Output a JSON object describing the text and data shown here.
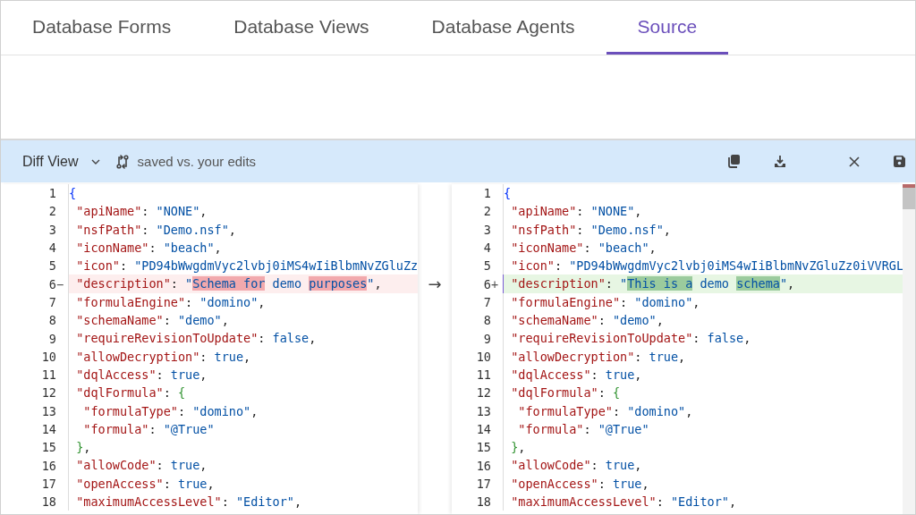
{
  "tabs": [
    {
      "label": "Database Forms",
      "selected": false
    },
    {
      "label": "Database Views",
      "selected": false
    },
    {
      "label": "Database Agents",
      "selected": false
    },
    {
      "label": "Source",
      "selected": true
    }
  ],
  "toolbar": {
    "view_mode": "Diff View",
    "comparison": "saved vs. your edits"
  },
  "editor": {
    "left": {
      "lines": [
        {
          "number": "1",
          "kind": "unchanged",
          "segments": [
            {
              "text": "{",
              "kind": "brace-outer"
            }
          ]
        },
        {
          "number": "2",
          "kind": "unchanged",
          "segments": [
            {
              "text": " \"apiName\"",
              "kind": "key"
            },
            {
              "text": ": ",
              "kind": "punct"
            },
            {
              "text": "\"NONE\"",
              "kind": "string"
            },
            {
              "text": ",",
              "kind": "punct"
            }
          ]
        },
        {
          "number": "3",
          "kind": "unchanged",
          "segments": [
            {
              "text": " \"nsfPath\"",
              "kind": "key"
            },
            {
              "text": ": ",
              "kind": "punct"
            },
            {
              "text": "\"Demo.nsf\"",
              "kind": "string"
            },
            {
              "text": ",",
              "kind": "punct"
            }
          ]
        },
        {
          "number": "4",
          "kind": "unchanged",
          "segments": [
            {
              "text": " \"iconName\"",
              "kind": "key"
            },
            {
              "text": ": ",
              "kind": "punct"
            },
            {
              "text": "\"beach\"",
              "kind": "string"
            },
            {
              "text": ",",
              "kind": "punct"
            }
          ]
        },
        {
          "number": "5",
          "kind": "unchanged",
          "segments": [
            {
              "text": " \"icon\"",
              "kind": "key"
            },
            {
              "text": ": ",
              "kind": "punct"
            },
            {
              "text": "\"PD94bWwgdmVyc2lvbj0iMS4wIiBlbmNvZGluZz",
              "kind": "string"
            }
          ]
        },
        {
          "number": "6",
          "kind": "removed",
          "marker": "−",
          "revert_arrow": "→",
          "segments": [
            {
              "text": " \"description\"",
              "kind": "key"
            },
            {
              "text": ": ",
              "kind": "punct"
            },
            {
              "text": "\"",
              "kind": "string"
            },
            {
              "text": "Schema for",
              "kind": "string",
              "highlight": true
            },
            {
              "text": " demo ",
              "kind": "string"
            },
            {
              "text": "purposes",
              "kind": "string",
              "highlight": true
            },
            {
              "text": "\"",
              "kind": "string"
            },
            {
              "text": ",",
              "kind": "punct"
            }
          ]
        },
        {
          "number": "7",
          "kind": "unchanged",
          "segments": [
            {
              "text": " \"formulaEngine\"",
              "kind": "key"
            },
            {
              "text": ": ",
              "kind": "punct"
            },
            {
              "text": "\"domino\"",
              "kind": "string"
            },
            {
              "text": ",",
              "kind": "punct"
            }
          ]
        },
        {
          "number": "8",
          "kind": "unchanged",
          "segments": [
            {
              "text": " \"schemaName\"",
              "kind": "key"
            },
            {
              "text": ": ",
              "kind": "punct"
            },
            {
              "text": "\"demo\"",
              "kind": "string"
            },
            {
              "text": ",",
              "kind": "punct"
            }
          ]
        },
        {
          "number": "9",
          "kind": "unchanged",
          "segments": [
            {
              "text": " \"requireRevisionToUpdate\"",
              "kind": "key"
            },
            {
              "text": ": ",
              "kind": "punct"
            },
            {
              "text": "false",
              "kind": "keyword"
            },
            {
              "text": ",",
              "kind": "punct"
            }
          ]
        },
        {
          "number": "10",
          "kind": "unchanged",
          "segments": [
            {
              "text": " \"allowDecryption\"",
              "kind": "key"
            },
            {
              "text": ": ",
              "kind": "punct"
            },
            {
              "text": "true",
              "kind": "keyword"
            },
            {
              "text": ",",
              "kind": "punct"
            }
          ]
        },
        {
          "number": "11",
          "kind": "unchanged",
          "segments": [
            {
              "text": " \"dqlAccess\"",
              "kind": "key"
            },
            {
              "text": ": ",
              "kind": "punct"
            },
            {
              "text": "true",
              "kind": "keyword"
            },
            {
              "text": ",",
              "kind": "punct"
            }
          ]
        },
        {
          "number": "12",
          "kind": "unchanged",
          "segments": [
            {
              "text": " \"dqlFormula\"",
              "kind": "key"
            },
            {
              "text": ": ",
              "kind": "punct"
            },
            {
              "text": "{",
              "kind": "brace-inner"
            }
          ]
        },
        {
          "number": "13",
          "kind": "unchanged",
          "segments": [
            {
              "text": "  \"formulaType\"",
              "kind": "key"
            },
            {
              "text": ": ",
              "kind": "punct"
            },
            {
              "text": "\"domino\"",
              "kind": "string"
            },
            {
              "text": ",",
              "kind": "punct"
            }
          ]
        },
        {
          "number": "14",
          "kind": "unchanged",
          "segments": [
            {
              "text": "  \"formula\"",
              "kind": "key"
            },
            {
              "text": ": ",
              "kind": "punct"
            },
            {
              "text": "\"@True\"",
              "kind": "string"
            }
          ]
        },
        {
          "number": "15",
          "kind": "unchanged",
          "segments": [
            {
              "text": " }",
              "kind": "brace-inner"
            },
            {
              "text": ",",
              "kind": "punct"
            }
          ]
        },
        {
          "number": "16",
          "kind": "unchanged",
          "segments": [
            {
              "text": " \"allowCode\"",
              "kind": "key"
            },
            {
              "text": ": ",
              "kind": "punct"
            },
            {
              "text": "true",
              "kind": "keyword"
            },
            {
              "text": ",",
              "kind": "punct"
            }
          ]
        },
        {
          "number": "17",
          "kind": "unchanged",
          "segments": [
            {
              "text": " \"openAccess\"",
              "kind": "key"
            },
            {
              "text": ": ",
              "kind": "punct"
            },
            {
              "text": "true",
              "kind": "keyword"
            },
            {
              "text": ",",
              "kind": "punct"
            }
          ]
        },
        {
          "number": "18",
          "kind": "unchanged",
          "segments": [
            {
              "text": " \"maximumAccessLevel\"",
              "kind": "key"
            },
            {
              "text": ": ",
              "kind": "punct"
            },
            {
              "text": "\"Editor\"",
              "kind": "string"
            },
            {
              "text": ",",
              "kind": "punct"
            }
          ]
        }
      ]
    },
    "right": {
      "lines": [
        {
          "number": "1",
          "kind": "unchanged",
          "segments": [
            {
              "text": "{",
              "kind": "brace-outer"
            }
          ]
        },
        {
          "number": "2",
          "kind": "unchanged",
          "segments": [
            {
              "text": " \"apiName\"",
              "kind": "key"
            },
            {
              "text": ": ",
              "kind": "punct"
            },
            {
              "text": "\"NONE\"",
              "kind": "string"
            },
            {
              "text": ",",
              "kind": "punct"
            }
          ]
        },
        {
          "number": "3",
          "kind": "unchanged",
          "segments": [
            {
              "text": " \"nsfPath\"",
              "kind": "key"
            },
            {
              "text": ": ",
              "kind": "punct"
            },
            {
              "text": "\"Demo.nsf\"",
              "kind": "string"
            },
            {
              "text": ",",
              "kind": "punct"
            }
          ]
        },
        {
          "number": "4",
          "kind": "unchanged",
          "segments": [
            {
              "text": " \"iconName\"",
              "kind": "key"
            },
            {
              "text": ": ",
              "kind": "punct"
            },
            {
              "text": "\"beach\"",
              "kind": "string"
            },
            {
              "text": ",",
              "kind": "punct"
            }
          ]
        },
        {
          "number": "5",
          "kind": "unchanged",
          "segments": [
            {
              "text": " \"icon\"",
              "kind": "key"
            },
            {
              "text": ": ",
              "kind": "punct"
            },
            {
              "text": "\"PD94bWwgdmVyc2lvbj0iMS4wIiBlbmNvZGluZz0iVVRGL",
              "kind": "string"
            }
          ]
        },
        {
          "number": "6",
          "kind": "added",
          "marker": "+",
          "segments": [
            {
              "text": " \"description\"",
              "kind": "key"
            },
            {
              "text": ": ",
              "kind": "punct"
            },
            {
              "text": "\"",
              "kind": "string"
            },
            {
              "text": "This is a",
              "kind": "string",
              "highlight": true
            },
            {
              "text": " demo ",
              "kind": "string"
            },
            {
              "text": "schema",
              "kind": "string",
              "highlight": true
            },
            {
              "text": "\"",
              "kind": "string"
            },
            {
              "text": ",",
              "kind": "punct"
            }
          ]
        },
        {
          "number": "7",
          "kind": "unchanged",
          "segments": [
            {
              "text": " \"formulaEngine\"",
              "kind": "key"
            },
            {
              "text": ": ",
              "kind": "punct"
            },
            {
              "text": "\"domino\"",
              "kind": "string"
            },
            {
              "text": ",",
              "kind": "punct"
            }
          ]
        },
        {
          "number": "8",
          "kind": "unchanged",
          "segments": [
            {
              "text": " \"schemaName\"",
              "kind": "key"
            },
            {
              "text": ": ",
              "kind": "punct"
            },
            {
              "text": "\"demo\"",
              "kind": "string"
            },
            {
              "text": ",",
              "kind": "punct"
            }
          ]
        },
        {
          "number": "9",
          "kind": "unchanged",
          "segments": [
            {
              "text": " \"requireRevisionToUpdate\"",
              "kind": "key"
            },
            {
              "text": ": ",
              "kind": "punct"
            },
            {
              "text": "false",
              "kind": "keyword"
            },
            {
              "text": ",",
              "kind": "punct"
            }
          ]
        },
        {
          "number": "10",
          "kind": "unchanged",
          "segments": [
            {
              "text": " \"allowDecryption\"",
              "kind": "key"
            },
            {
              "text": ": ",
              "kind": "punct"
            },
            {
              "text": "true",
              "kind": "keyword"
            },
            {
              "text": ",",
              "kind": "punct"
            }
          ]
        },
        {
          "number": "11",
          "kind": "unchanged",
          "segments": [
            {
              "text": " \"dqlAccess\"",
              "kind": "key"
            },
            {
              "text": ": ",
              "kind": "punct"
            },
            {
              "text": "true",
              "kind": "keyword"
            },
            {
              "text": ",",
              "kind": "punct"
            }
          ]
        },
        {
          "number": "12",
          "kind": "unchanged",
          "segments": [
            {
              "text": " \"dqlFormula\"",
              "kind": "key"
            },
            {
              "text": ": ",
              "kind": "punct"
            },
            {
              "text": "{",
              "kind": "brace-inner"
            }
          ]
        },
        {
          "number": "13",
          "kind": "unchanged",
          "segments": [
            {
              "text": "  \"formulaType\"",
              "kind": "key"
            },
            {
              "text": ": ",
              "kind": "punct"
            },
            {
              "text": "\"domino\"",
              "kind": "string"
            },
            {
              "text": ",",
              "kind": "punct"
            }
          ]
        },
        {
          "number": "14",
          "kind": "unchanged",
          "segments": [
            {
              "text": "  \"formula\"",
              "kind": "key"
            },
            {
              "text": ": ",
              "kind": "punct"
            },
            {
              "text": "\"@True\"",
              "kind": "string"
            }
          ]
        },
        {
          "number": "15",
          "kind": "unchanged",
          "segments": [
            {
              "text": " }",
              "kind": "brace-inner"
            },
            {
              "text": ",",
              "kind": "punct"
            }
          ]
        },
        {
          "number": "16",
          "kind": "unchanged",
          "segments": [
            {
              "text": " \"allowCode\"",
              "kind": "key"
            },
            {
              "text": ": ",
              "kind": "punct"
            },
            {
              "text": "true",
              "kind": "keyword"
            },
            {
              "text": ",",
              "kind": "punct"
            }
          ]
        },
        {
          "number": "17",
          "kind": "unchanged",
          "segments": [
            {
              "text": " \"openAccess\"",
              "kind": "key"
            },
            {
              "text": ": ",
              "kind": "punct"
            },
            {
              "text": "true",
              "kind": "keyword"
            },
            {
              "text": ",",
              "kind": "punct"
            }
          ]
        },
        {
          "number": "18",
          "kind": "unchanged",
          "segments": [
            {
              "text": " \"maximumAccessLevel\"",
              "kind": "key"
            },
            {
              "text": ": ",
              "kind": "punct"
            },
            {
              "text": "\"Editor\"",
              "kind": "string"
            },
            {
              "text": ",",
              "kind": "punct"
            }
          ]
        }
      ]
    }
  }
}
